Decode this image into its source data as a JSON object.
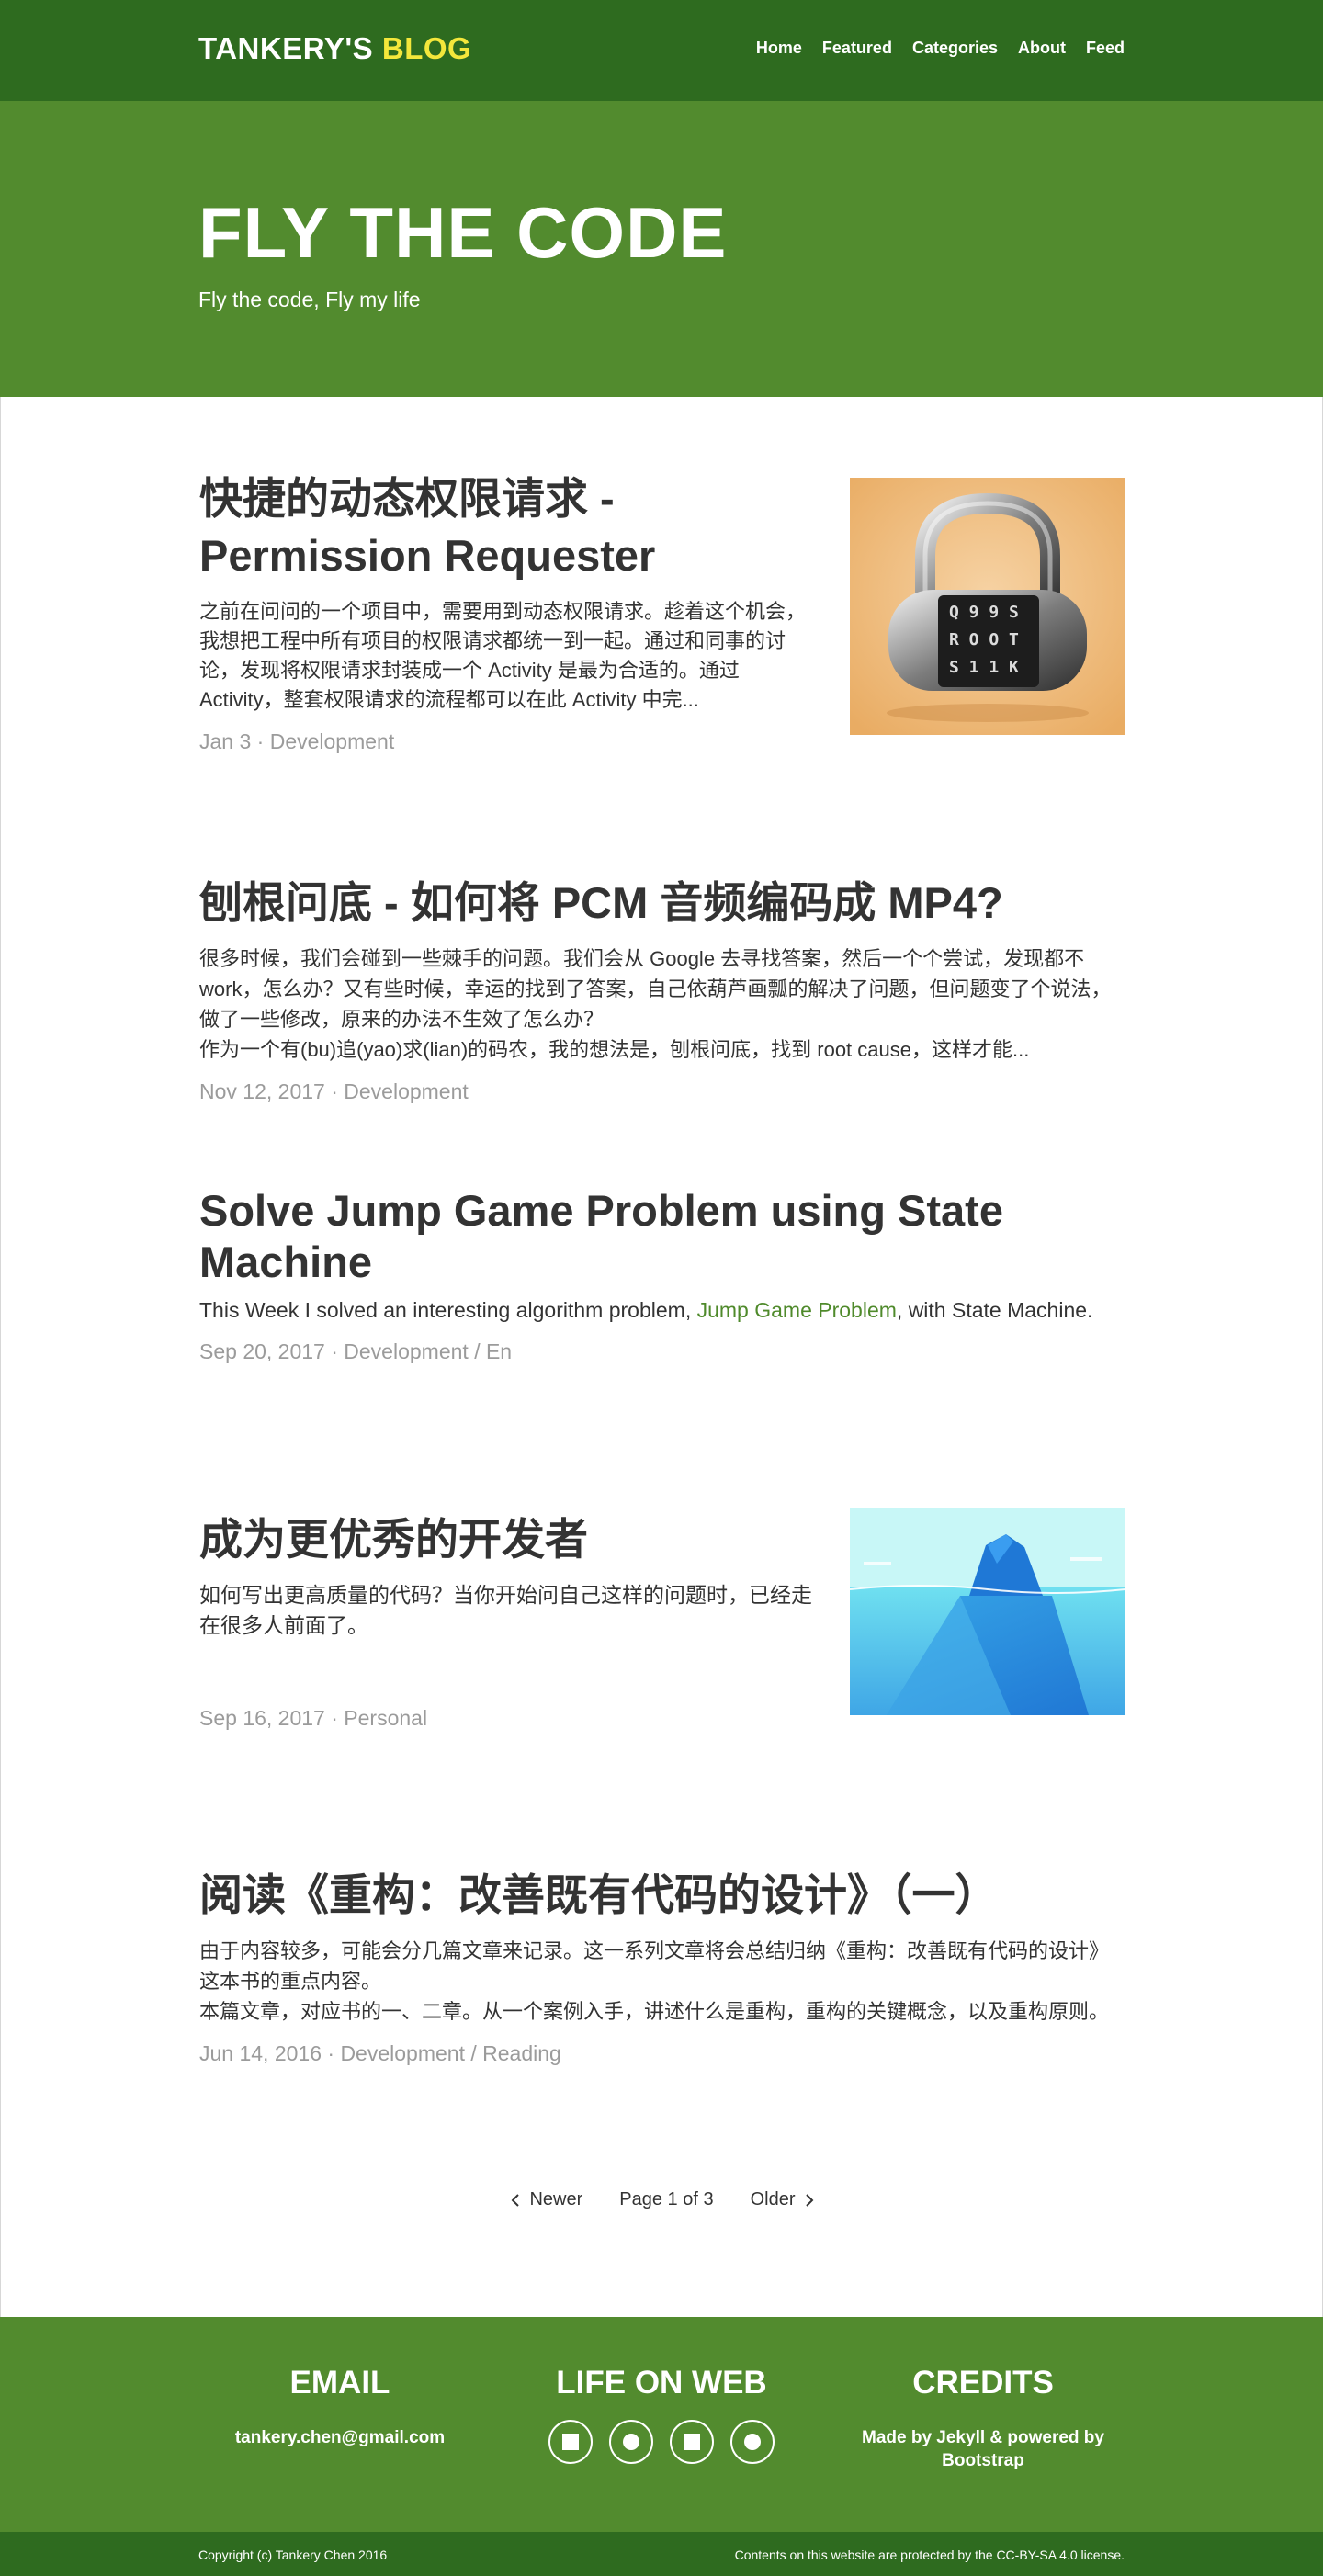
{
  "header": {
    "brand_main": "TANKERY'S",
    "brand_accent": "BLOG",
    "nav": [
      "Home",
      "Featured",
      "Categories",
      "About",
      "Feed"
    ]
  },
  "hero": {
    "title": "FLY THE CODE",
    "subtitle": "Fly the code, Fly my life"
  },
  "posts": [
    {
      "title_line1": "快捷的动态权限请求 -",
      "title_line2": "Permission Requester",
      "excerpt": "之前在问问的一个项目中，需要用到动态权限请求。趁着这个机会，我想把工程中所有项目的权限请求都统一到一起。通过和同事的讨论，发现将权限请求封装成一个 Activity 是最为合适的。通过 Activity，整套权限请求的流程都可以在此 Activity 中完...",
      "meta": "Jan 3 · Development"
    },
    {
      "title": "刨根问底 - 如何将 PCM 音频编码成 MP4?",
      "excerpt_line1": "很多时候，我们会碰到一些棘手的问题。我们会从 Google 去寻找答案，然后一个个尝试，发现都不 work，怎么办？又有些时候，幸运的找到了答案，自己依葫芦画瓢的解决了问题，但问题变了个说法，做了一些修改，原来的办法不生效了怎么办？",
      "excerpt_line2": "作为一个有(bu)追(yao)求(lian)的码农，我的想法是，刨根问底，找到 root cause，这样才能...",
      "meta": "Nov 12, 2017 · Development"
    },
    {
      "title": "Solve Jump Game Problem using State Machine",
      "excerpt_before": "This Week I solved an interesting algorithm problem, ",
      "excerpt_link": "Jump Game Problem",
      "excerpt_after": ", with State Machine.",
      "meta": "Sep 20, 2017 · Development / En"
    },
    {
      "title": "成为更优秀的开发者",
      "excerpt": "如何写出更高质量的代码？当你开始问自己这样的问题时，已经走在很多人前面了。",
      "meta": "Sep 16, 2017 · Personal"
    },
    {
      "title": "阅读《重构：改善既有代码的设计》（一）",
      "excerpt_line1": "由于内容较多，可能会分几篇文章来记录。这一系列文章将会总结归纳《重构：改善既有代码的设计》这本书的重点内容。",
      "excerpt_line2": "本篇文章，对应书的一、二章。从一个案例入手，讲述什么是重构，重构的关键概念，以及重构原则。",
      "meta": "Jun 14, 2016 · Development / Reading"
    }
  ],
  "pagination": {
    "newer": "Newer",
    "page": "Page 1 of 3",
    "older": "Older"
  },
  "footer": {
    "email_title": "EMAIL",
    "email": "tankery.chen@gmail.com",
    "web_title": "LIFE ON WEB",
    "credits_title": "CREDITS",
    "credits": "Made by Jekyll & powered by Bootstrap",
    "copyright": "Copyright (c) Tankery Chen 2016",
    "license": "Contents on this website are protected by the CC-BY-SA 4.0 license."
  }
}
